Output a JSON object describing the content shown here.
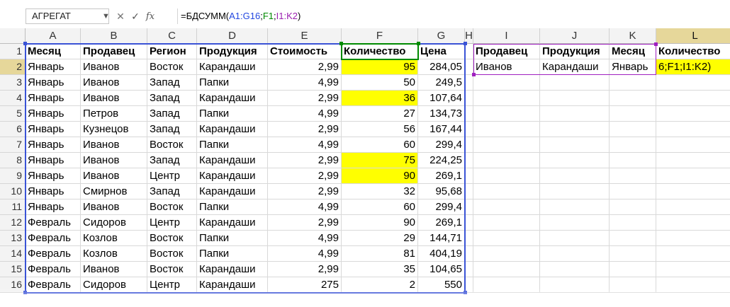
{
  "formula_bar": {
    "name_box": "АГРЕГАТ",
    "icons": [
      "cancel-icon",
      "enter-icon",
      "function-icon"
    ],
    "formula_prefix": "=БДСУММ(",
    "ref1": "A1:G16",
    "sep1": ";",
    "ref2": "F1",
    "sep2": ";",
    "ref3": "I1:K2",
    "suffix": ")"
  },
  "columns": [
    "A",
    "B",
    "C",
    "D",
    "E",
    "F",
    "G",
    "H",
    "I",
    "J",
    "K",
    "L"
  ],
  "rows": [
    "1",
    "2",
    "3",
    "4",
    "5",
    "6",
    "7",
    "8",
    "9",
    "10",
    "11",
    "12",
    "13",
    "14",
    "15",
    "16"
  ],
  "active": {
    "column": "L",
    "row": "2"
  },
  "table": {
    "headers": [
      "Месяц",
      "Продавец",
      "Регион",
      "Продукция",
      "Стоимость",
      "Количество",
      "Цена"
    ],
    "records": [
      [
        "Январь",
        "Иванов",
        "Восток",
        "Карандаши",
        "2,99",
        "95",
        "284,05"
      ],
      [
        "Январь",
        "Иванов",
        "Запад",
        "Папки",
        "4,99",
        "50",
        "249,5"
      ],
      [
        "Январь",
        "Иванов",
        "Запад",
        "Карандаши",
        "2,99",
        "36",
        "107,64"
      ],
      [
        "Январь",
        "Петров",
        "Запад",
        "Папки",
        "4,99",
        "27",
        "134,73"
      ],
      [
        "Январь",
        "Кузнецов",
        "Запад",
        "Карандаши",
        "2,99",
        "56",
        "167,44"
      ],
      [
        "Январь",
        "Иванов",
        "Восток",
        "Папки",
        "4,99",
        "60",
        "299,4"
      ],
      [
        "Январь",
        "Иванов",
        "Запад",
        "Карандаши",
        "2,99",
        "75",
        "224,25"
      ],
      [
        "Январь",
        "Иванов",
        "Центр",
        "Карандаши",
        "2,99",
        "90",
        "269,1"
      ],
      [
        "Январь",
        "Смирнов",
        "Запад",
        "Карандаши",
        "2,99",
        "32",
        "95,68"
      ],
      [
        "Январь",
        "Иванов",
        "Восток",
        "Папки",
        "4,99",
        "60",
        "299,4"
      ],
      [
        "Февраль",
        "Сидоров",
        "Центр",
        "Карандаши",
        "2,99",
        "90",
        "269,1"
      ],
      [
        "Февраль",
        "Козлов",
        "Восток",
        "Папки",
        "4,99",
        "29",
        "144,71"
      ],
      [
        "Февраль",
        "Козлов",
        "Восток",
        "Папки",
        "4,99",
        "81",
        "404,19"
      ],
      [
        "Февраль",
        "Иванов",
        "Восток",
        "Карандаши",
        "2,99",
        "35",
        "104,65"
      ],
      [
        "Февраль",
        "Сидоров",
        "Центр",
        "Карандаши",
        "275",
        "2",
        "550"
      ]
    ],
    "highlighted_rows": [
      1,
      3,
      7,
      8
    ],
    "highlight_color": "#ffff00"
  },
  "criteria": {
    "headers": [
      "Продавец",
      "Продукция",
      "Месяц"
    ],
    "values": [
      "Иванов",
      "Карандаши",
      "Январь"
    ]
  },
  "result": {
    "header": "Количество",
    "editing_text": "6;F1;I1:K2)"
  },
  "colors": {
    "range_blue": "#3a53d6",
    "range_green": "#008a00",
    "range_purple": "#a020c0",
    "active_header": "#e6d79a"
  }
}
